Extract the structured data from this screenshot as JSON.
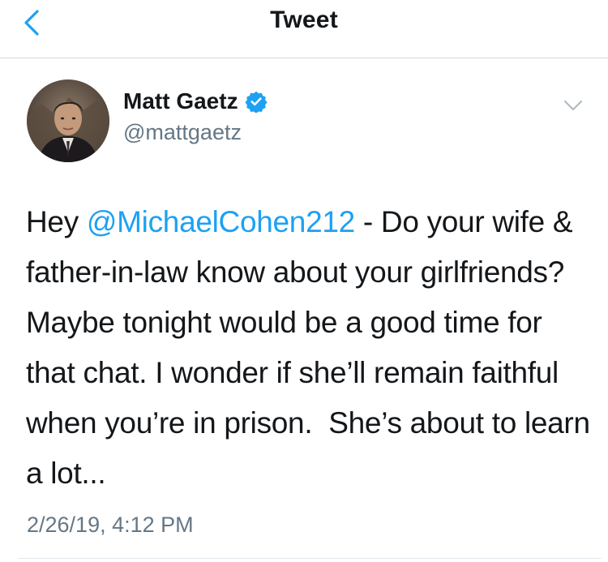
{
  "nav": {
    "title": "Tweet",
    "back_icon": "chevron-left-icon"
  },
  "tweet": {
    "author": {
      "name": "Matt Gaetz",
      "handle": "@mattgaetz",
      "verified": true,
      "verified_icon": "verified-badge-icon"
    },
    "text_parts": {
      "lead": "Hey ",
      "mention": "@MichaelCohen212",
      "body": " - Do your wife & father-in-law know about your girlfriends? Maybe tonight would be a good time for that chat. I wonder if she’ll remain faithful when you’re in prison.  She’s about to learn a lot..."
    },
    "timestamp": "2/26/19, 4:12 PM",
    "menu_icon": "chevron-down-icon"
  },
  "colors": {
    "accent": "#1da1f2",
    "text": "#14171a",
    "secondary": "#657786",
    "divider": "#d6d6d6"
  }
}
